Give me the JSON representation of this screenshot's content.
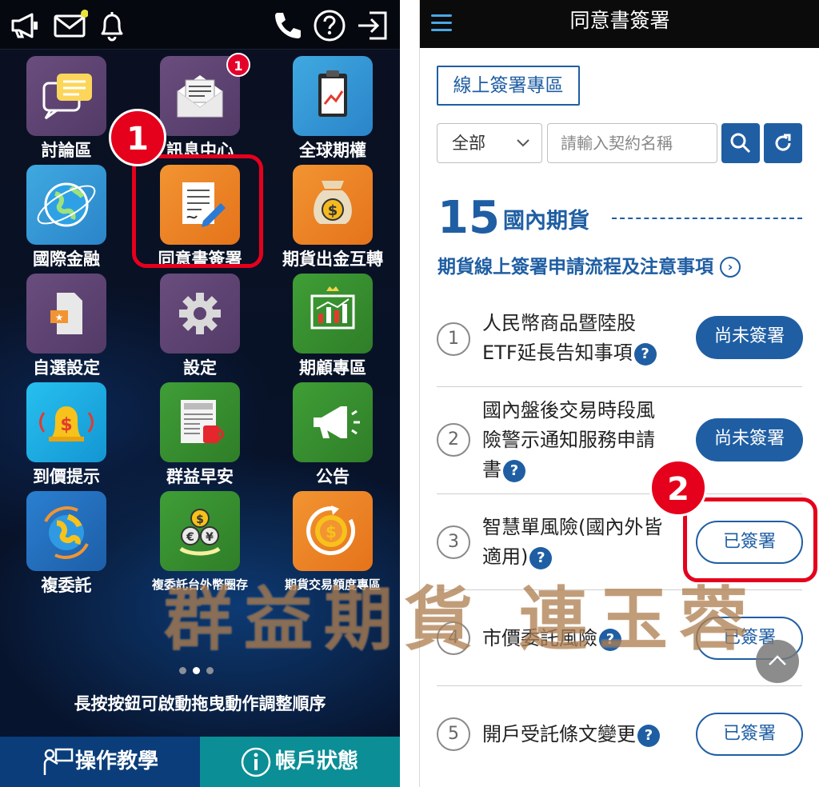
{
  "left_app": {
    "tiles": {
      "discussion": "討論區",
      "messages": "訊息中心",
      "messages_badge": "1",
      "global_options": "全球期權",
      "intl_finance": "國際金融",
      "consent_sign": "同意書簽署",
      "futures_transfer": "期貨出金互轉",
      "custom_settings": "自選設定",
      "settings": "設定",
      "advisory_zone": "期顧專區",
      "price_alert": "到價提示",
      "morning_news": "群益早安",
      "announcement": "公告",
      "re_delegation": "複委託",
      "re_delegation_fx": "複委託台外幣圈存",
      "futures_quota": "期貨交易額度專區"
    },
    "hint": "長按按鈕可啟動拖曳動作調整順序",
    "bottom": {
      "tutorial": "操作教學",
      "account_status": "帳戶狀態"
    },
    "callout_1": "1"
  },
  "right_app": {
    "title": "同意書簽署",
    "online_zone": "線上簽署專區",
    "filter_selected": "全部",
    "search_placeholder": "請輸入契約名稱",
    "section_count": "15",
    "section_title": "國內期貨",
    "section_link": "期貨線上簽署申請流程及注意事項",
    "callout_2": "2",
    "items": [
      {
        "num": "1",
        "line1": "人民幣商品暨陸股",
        "line2": "ETF延長告知事項",
        "status": "尚未簽署"
      },
      {
        "num": "2",
        "line1": "國內盤後交易時段風",
        "line2": "險警示通知服務申請",
        "line3": "書",
        "status": "尚未簽署"
      },
      {
        "num": "3",
        "line1": "智慧單風險(國內外皆",
        "line2": "適用)",
        "status": "已簽署"
      },
      {
        "num": "4",
        "line1": "市價委託風險",
        "status": "已簽署"
      },
      {
        "num": "5",
        "line1": "開戶受託條文變更",
        "status": "已簽署"
      }
    ]
  },
  "watermark": "群益期貨 連玉蓉",
  "colors": {
    "accent_blue": "#1f5ea3",
    "callout_red": "#e5001c",
    "bottom_left": "#0a3d7a",
    "bottom_right": "#0b8e96"
  },
  "icons": [
    "megaphone-icon",
    "mail-icon",
    "bell-icon",
    "phone-icon",
    "help-icon",
    "logout-icon",
    "hamburger-icon",
    "search-icon",
    "refresh-icon",
    "chevron-down-icon",
    "chevron-right-icon",
    "chevron-up-icon"
  ]
}
